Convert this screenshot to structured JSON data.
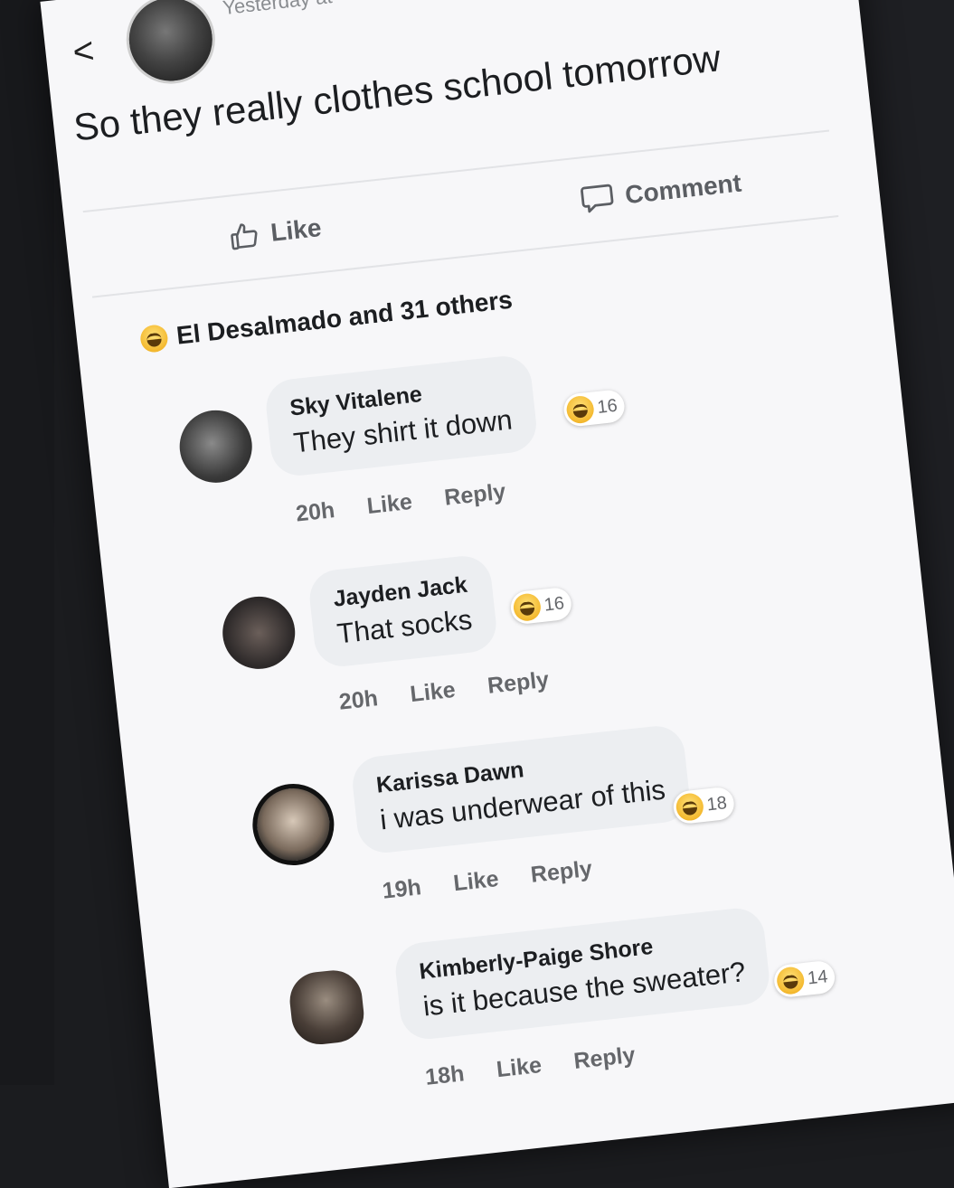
{
  "post": {
    "back": "<",
    "timestamp": "Yesterday at ",
    "text": "So they really clothes school tomorrow",
    "like_label": "Like",
    "comment_label": "Comment",
    "reactions_summary": "El Desalmado and 31 others"
  },
  "comments": [
    {
      "name": "Sky Vitalene",
      "text": "They shirt it down",
      "reactions": "16",
      "time": "20h",
      "like": "Like",
      "reply": "Reply"
    },
    {
      "name": "Jayden Jack",
      "text": "That socks",
      "reactions": "16",
      "time": "20h",
      "like": "Like",
      "reply": "Reply"
    },
    {
      "name": "Karissa Dawn",
      "text": "i was underwear of this",
      "reactions": "18",
      "time": "19h",
      "like": "Like",
      "reply": "Reply"
    },
    {
      "name": "Kimberly-Paige Shore",
      "text": "is it because the sweater?",
      "reactions": "14",
      "time": "18h",
      "like": "Like",
      "reply": "Reply"
    }
  ],
  "colors": {
    "reaction_emoji": "#f4b92f",
    "bubble": "#eceef1",
    "meta_text": "#65676b"
  },
  "icons": {
    "back": "chevron-left-icon",
    "like": "thumbs-up-icon",
    "comment": "comment-bubble-icon",
    "reaction": "laughing-emoji-icon"
  }
}
